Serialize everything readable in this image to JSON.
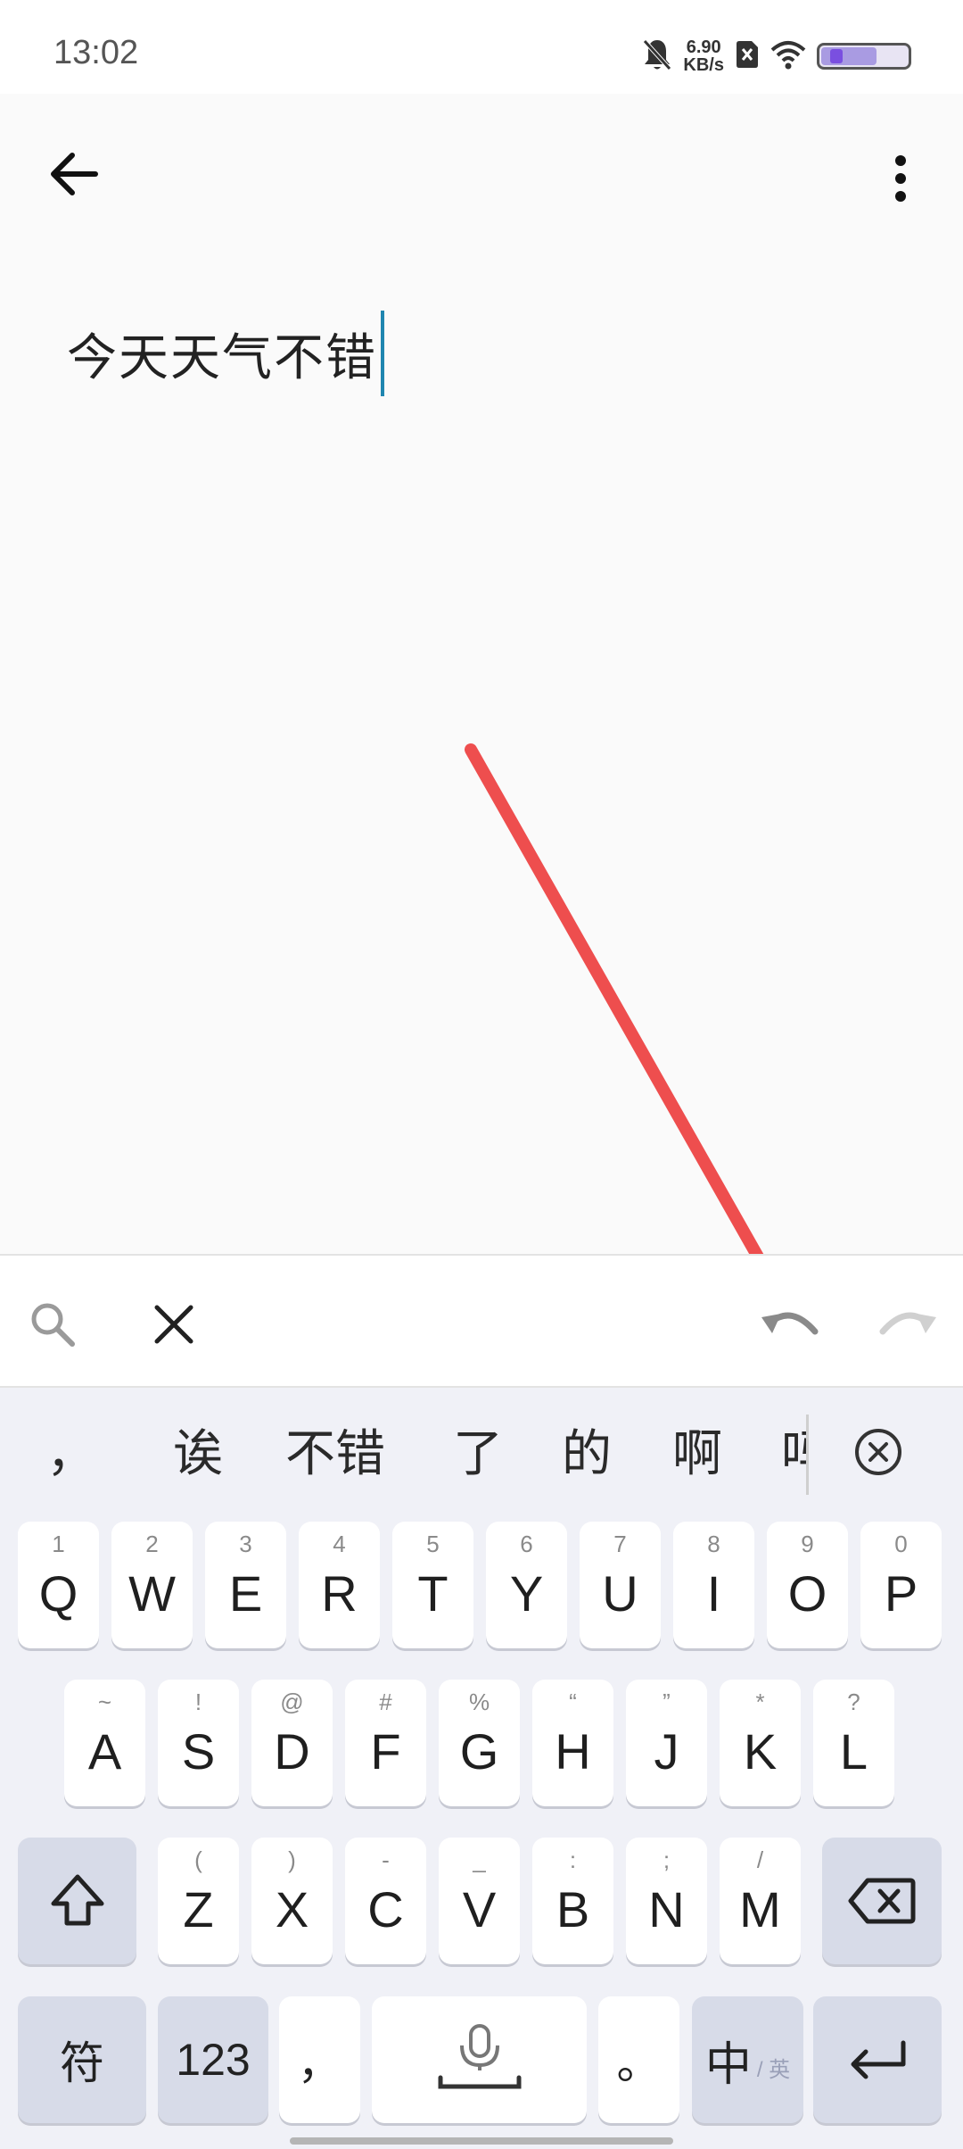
{
  "status_bar": {
    "time": "13:02",
    "net_speed_value": "6.90",
    "net_speed_unit": "KB/s",
    "icons": [
      "bell-mute-icon",
      "no-sim-icon",
      "wifi-icon",
      "battery-icon"
    ],
    "battery_level": 0.65
  },
  "app_bar": {
    "back_icon": "arrow-left-icon",
    "menu_icon": "more-vertical-icon"
  },
  "editor": {
    "text": "今天天气不错"
  },
  "toolbar": {
    "search_icon": "search-icon",
    "clear_icon": "close-icon",
    "undo_icon": "undo-icon",
    "redo_icon": "redo-icon"
  },
  "candidates": {
    "punct": "，",
    "items": [
      "诶",
      "不错",
      "了",
      "的",
      "啊"
    ],
    "partial": "吗",
    "close_icon": "circle-close-icon"
  },
  "keyboard": {
    "row1": [
      {
        "main": "Q",
        "sub": "1"
      },
      {
        "main": "W",
        "sub": "2"
      },
      {
        "main": "E",
        "sub": "3"
      },
      {
        "main": "R",
        "sub": "4"
      },
      {
        "main": "T",
        "sub": "5"
      },
      {
        "main": "Y",
        "sub": "6"
      },
      {
        "main": "U",
        "sub": "7"
      },
      {
        "main": "I",
        "sub": "8"
      },
      {
        "main": "O",
        "sub": "9"
      },
      {
        "main": "P",
        "sub": "0"
      }
    ],
    "row2": [
      {
        "main": "A",
        "sub": "~"
      },
      {
        "main": "S",
        "sub": "!"
      },
      {
        "main": "D",
        "sub": "@"
      },
      {
        "main": "F",
        "sub": "#"
      },
      {
        "main": "G",
        "sub": "%"
      },
      {
        "main": "H",
        "sub": "“"
      },
      {
        "main": "J",
        "sub": "”"
      },
      {
        "main": "K",
        "sub": "*"
      },
      {
        "main": "L",
        "sub": "?"
      }
    ],
    "row3": [
      {
        "main": "Z",
        "sub": "("
      },
      {
        "main": "X",
        "sub": ")"
      },
      {
        "main": "C",
        "sub": "-"
      },
      {
        "main": "V",
        "sub": "_"
      },
      {
        "main": "B",
        "sub": ":"
      },
      {
        "main": "N",
        "sub": ";"
      },
      {
        "main": "M",
        "sub": "/"
      }
    ],
    "symbols_label": "符",
    "numbers_label": "123",
    "comma_label": "，",
    "period_label": "。",
    "lang_main": "中",
    "lang_sub": "/ 英",
    "shift_icon": "shift-icon",
    "backspace_icon": "backspace-icon",
    "mic_icon": "mic-icon",
    "enter_icon": "enter-icon"
  },
  "annotation": {
    "type": "arrow",
    "color": "#ee4e4e",
    "points_to": "undo-button"
  }
}
